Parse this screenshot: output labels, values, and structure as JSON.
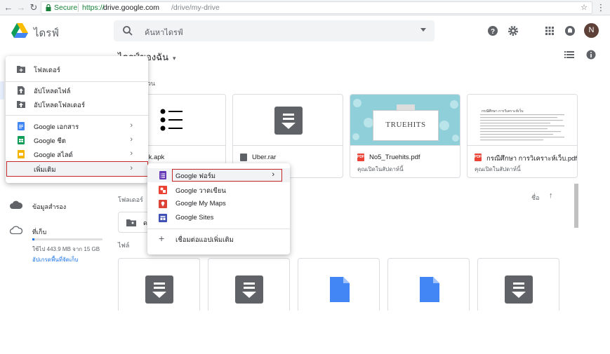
{
  "browser": {
    "secure_label": "Secure",
    "url_scheme": "https://",
    "url_host": "drive.google.com",
    "url_path": "/drive/my-drive"
  },
  "app": {
    "title": "ไดรฟ์"
  },
  "search": {
    "placeholder": "ค้นหาไดรฟ์"
  },
  "avatar_letter": "N",
  "main": {
    "title": "ไดรฟ์ของฉัน",
    "quick_access_label": "ด่วน",
    "folders_label": "โฟลเดอร์",
    "files_label": "ไฟล์",
    "sort_label": "ชื่อ"
  },
  "quick_cards": [
    {
      "name": "ank.apk",
      "sub": ""
    },
    {
      "name": "Uber.rar",
      "sub": ""
    },
    {
      "name": "No5_Truehits.pdf",
      "sub": "คุณเปิดในสัปดาห์นี้",
      "thumb_text": "TRUEHITS"
    },
    {
      "name": "กรณีศึกษา การวิเคราะห์เว็บ.pdf",
      "sub": "คุณเปิดในสัปดาห์นี้",
      "thumb_title": "กรณีศึกษา การวิเคราะห์เว็บ"
    }
  ],
  "sidebar": {
    "backup": "ข้อมูลสำรอง",
    "storage": "ที่เก็บ",
    "usage": "ใช้ไป 443.9 MB จาก 15 GB",
    "upgrade": "อัปเกรดพื้นที่จัดเก็บ",
    "usage_fraction": 0.03
  },
  "new_menu": {
    "items": [
      {
        "label": "โฟลเดอร์"
      },
      {
        "label": "อัปโหลดไฟล์"
      },
      {
        "label": "อัปโหลดโฟลเดอร์"
      },
      {
        "label": "Google เอกสาร"
      },
      {
        "label": "Google ชีต"
      },
      {
        "label": "Google สไลด์"
      },
      {
        "label": "เพิ่มเติม"
      }
    ]
  },
  "more_menu": {
    "items": [
      {
        "label": "Google ฟอร์ม"
      },
      {
        "label": "Google วาดเขียน"
      },
      {
        "label": "Google My Maps"
      },
      {
        "label": "Google Sites"
      },
      {
        "label": "เชื่อมต่อแอปเพิ่มเติม"
      }
    ]
  },
  "colors": {
    "docs": "#4285f4",
    "sheets": "#0f9d58",
    "slides": "#f4b400",
    "forms": "#673ab7",
    "drawings": "#ea4335",
    "mymaps": "#db4437",
    "sites": "#3f51b5",
    "highlight": "#c62828"
  }
}
